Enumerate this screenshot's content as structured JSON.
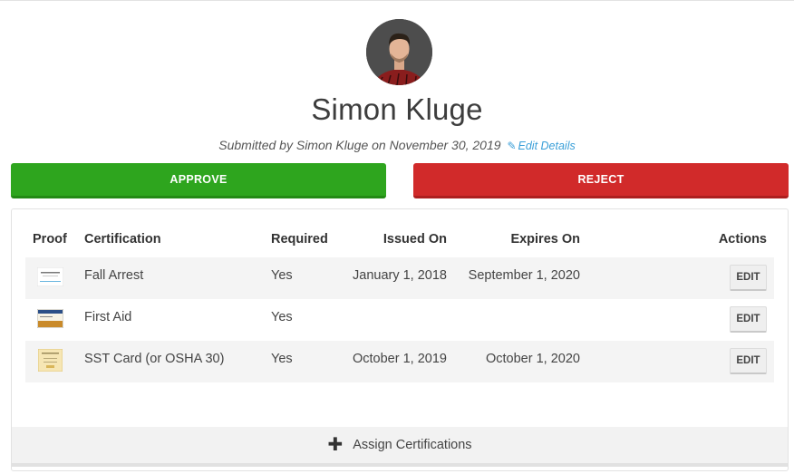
{
  "profile": {
    "name": "Simon Kluge",
    "submitted_text": "Submitted by Simon Kluge on November 30, 2019",
    "edit_details_label": "Edit Details"
  },
  "actions": {
    "approve_label": "APPROVE",
    "reject_label": "REJECT"
  },
  "table": {
    "headers": {
      "proof": "Proof",
      "certification": "Certification",
      "required": "Required",
      "issued_on": "Issued On",
      "expires_on": "Expires On",
      "actions": "Actions"
    },
    "rows": [
      {
        "certification": "Fall Arrest",
        "required": "Yes",
        "issued_on": "January 1, 2018",
        "expires_on": "September 1, 2020",
        "edit_label": "EDIT"
      },
      {
        "certification": "First Aid",
        "required": "Yes",
        "issued_on": "",
        "expires_on": "",
        "edit_label": "EDIT"
      },
      {
        "certification": "SST Card (or OSHA 30)",
        "required": "Yes",
        "issued_on": "October 1, 2019",
        "expires_on": "October 1, 2020",
        "edit_label": "EDIT"
      }
    ]
  },
  "assign": {
    "label": "Assign Certifications"
  },
  "colors": {
    "approve": "#2ea51e",
    "reject": "#d12a2a",
    "link": "#3a9fd8"
  }
}
